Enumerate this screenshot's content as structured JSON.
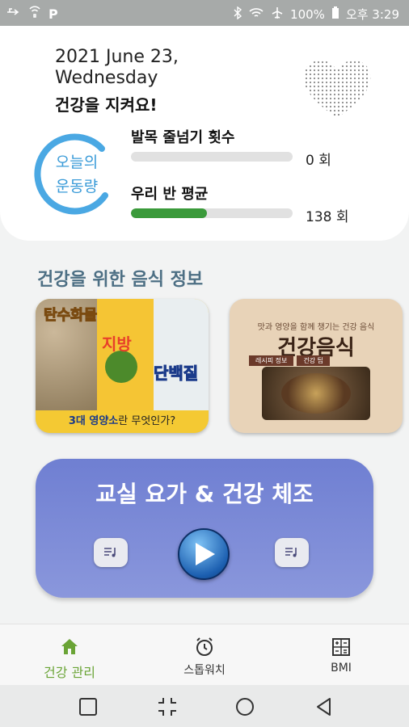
{
  "status_bar": {
    "left_icons": [
      "usb-icon",
      "wifi-calling-icon",
      "p-icon"
    ],
    "p_label": "P",
    "battery": "100%",
    "time": "오후 3:29"
  },
  "header": {
    "date_line1": "2021 June 23,",
    "date_line2": "Wednesday",
    "tagline": "건강을 지켜요!",
    "ring_label_line1": "오늘의",
    "ring_label_line2": "운동량",
    "ring_color": "#3a9bd8"
  },
  "stats": {
    "ankle_label": "발목 줄넘기 횟수",
    "ankle_value": "0 회",
    "ankle_progress": 0,
    "class_avg_label": "우리 반 평균",
    "class_avg_value": "138 회",
    "class_avg_progress": 0.47,
    "bar_color": "#3a9a3a"
  },
  "food_section": {
    "title": "건강을 위한 음식 정보",
    "card1": {
      "label_carb": "탄수화물",
      "label_fat": "지방",
      "label_protein": "단백질",
      "caption_bold": "3대 영양소",
      "caption_rest": "란 무엇인가?"
    },
    "card2": {
      "small_title": "맛과 영양을 함께 챙기는 건강 음식",
      "title": "건강음식",
      "tag1": "레시피 정보",
      "tag2": "건강 팁"
    }
  },
  "yoga": {
    "title": "교실 요가 & 건강 체조",
    "bg_color": "#7a88d6"
  },
  "bottom_nav": {
    "items": [
      {
        "label": "건강 관리",
        "icon": "home-icon",
        "active": true
      },
      {
        "label": "스톱워치",
        "icon": "alarm-clock-icon",
        "active": false
      },
      {
        "label": "BMI",
        "icon": "calculator-icon",
        "active": false
      }
    ],
    "active_color": "#6aa436"
  }
}
